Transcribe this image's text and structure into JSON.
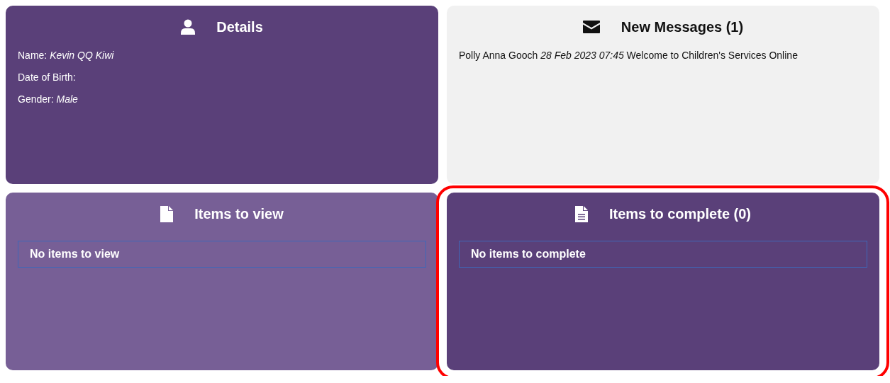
{
  "panels": [
    {
      "kind": "details",
      "title": "Details",
      "highlighted": false,
      "lines": [
        "Name: *Kevin QQ Kiwi*",
        "Date of Birth:",
        "Gender: *Male*"
      ]
    },
    {
      "kind": "messages",
      "title": "New Messages (1)",
      "highlighted": false,
      "lines": [
        "Polly Anna Gooch *28 Feb 2023 07:45* Welcome to Children's Services Online"
      ]
    },
    {
      "kind": "view-list",
      "title": "Items to view",
      "highlighted": false,
      "items": [
        "No items to view"
      ]
    },
    {
      "kind": "complete-list",
      "title": "Items to complete (0)",
      "highlighted": true,
      "items": [
        "No items to complete"
      ]
    }
  ]
}
